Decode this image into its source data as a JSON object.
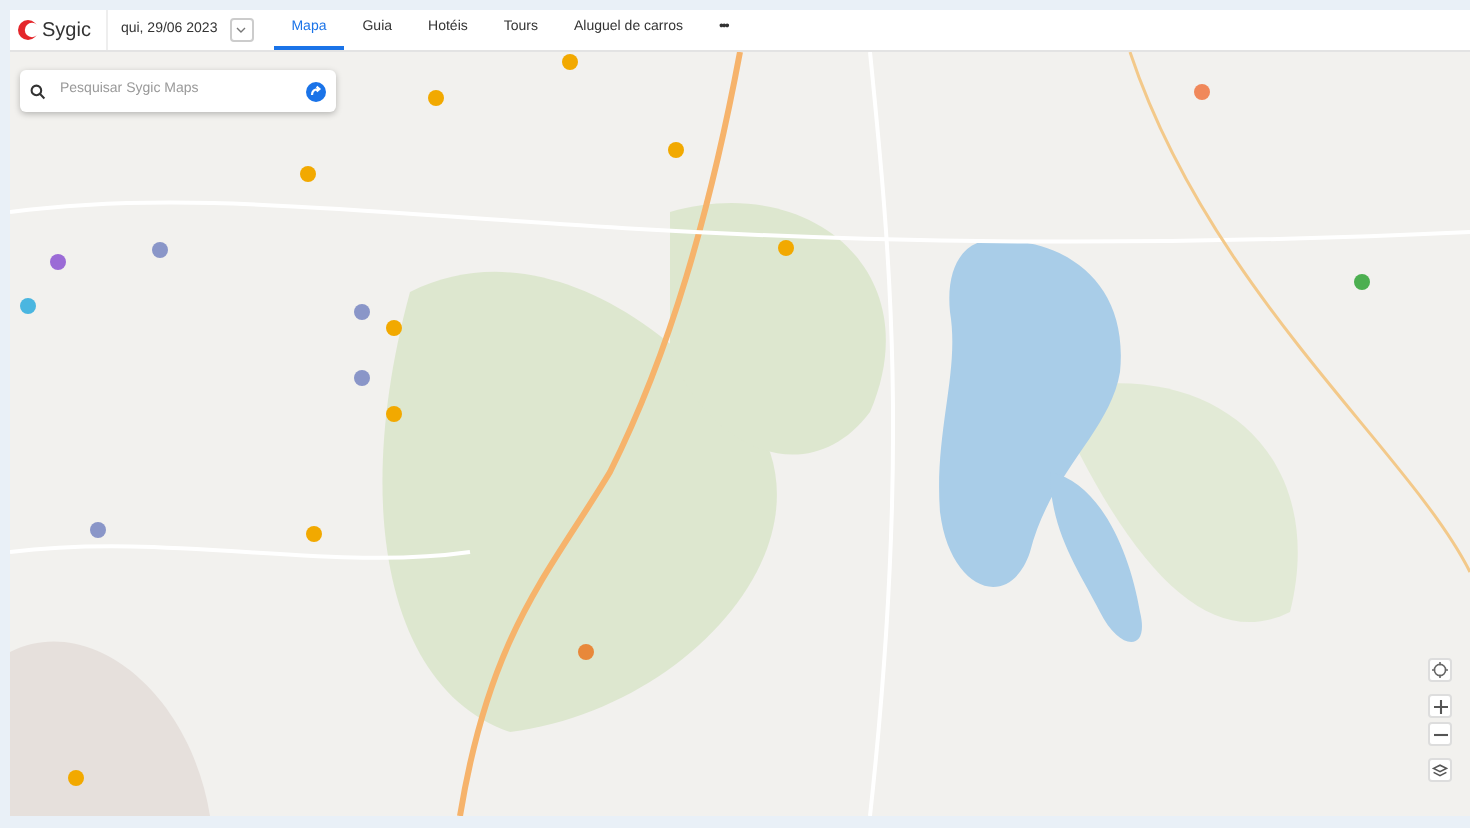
{
  "brand": {
    "name": "Sygic"
  },
  "date_picker": {
    "value": "qui, 29/06 2023"
  },
  "tabs": [
    {
      "label": "Mapa",
      "selected": true
    },
    {
      "label": "Guia",
      "selected": false
    },
    {
      "label": "Hotéis",
      "selected": false
    },
    {
      "label": "Tours",
      "selected": false
    },
    {
      "label": "Aluguel de carros",
      "selected": false
    }
  ],
  "more": {
    "label": "•••"
  },
  "search": {
    "placeholder": "Pesquisar Sygic Maps"
  }
}
